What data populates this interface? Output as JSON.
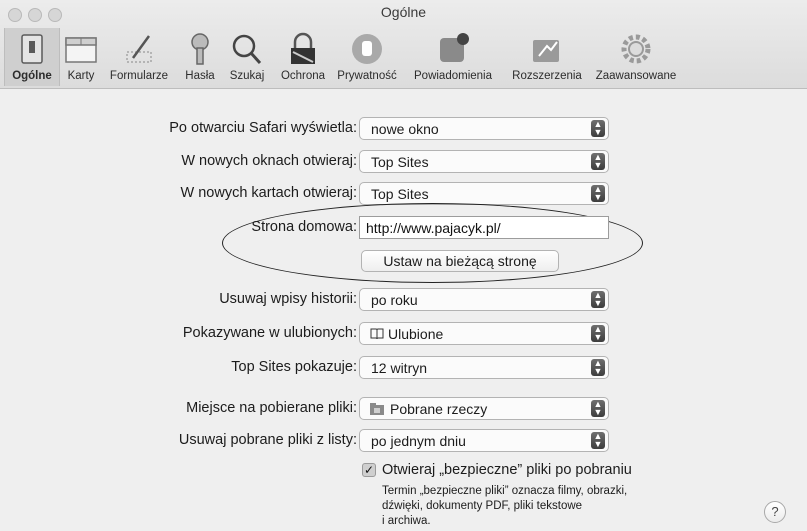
{
  "window": {
    "title": "Ogólne"
  },
  "toolbar": {
    "items": [
      {
        "label": "Ogólne"
      },
      {
        "label": "Karty"
      },
      {
        "label": "Formularze"
      },
      {
        "label": "Hasła"
      },
      {
        "label": "Szukaj"
      },
      {
        "label": "Ochrona"
      },
      {
        "label": "Prywatność"
      },
      {
        "label": "Powiadomienia"
      },
      {
        "label": "Rozszerzenia"
      },
      {
        "label": "Zaawansowane"
      }
    ]
  },
  "settings": {
    "open_with": {
      "label": "Po otwarciu Safari wyświetla:",
      "value": "nowe okno"
    },
    "new_windows": {
      "label": "W nowych oknach otwieraj:",
      "value": "Top Sites"
    },
    "new_tabs": {
      "label": "W nowych kartach otwieraj:",
      "value": "Top Sites"
    },
    "homepage": {
      "label": "Strona domowa:",
      "value": "http://www.pajacyk.pl/",
      "button": "Ustaw na bieżącą stronę"
    },
    "history": {
      "label": "Usuwaj wpisy historii:",
      "value": "po roku"
    },
    "favorites": {
      "label": "Pokazywane w ulubionych:",
      "value": "Ulubione"
    },
    "top_sites": {
      "label": "Top Sites pokazuje:",
      "value": "12 witryn"
    },
    "download_location": {
      "label": "Miejsce na pobierane pliki:",
      "value": "Pobrane rzeczy"
    },
    "remove_downloads": {
      "label": "Usuwaj pobrane pliki z listy:",
      "value": "po jednym dniu"
    },
    "safe_files": {
      "label": "Otwieraj „bezpieczne” pliki po pobraniu",
      "checked": true,
      "description_lines": [
        "Termin „bezpieczne pliki” oznacza filmy, obrazki,",
        "dźwięki, dokumenty PDF, pliki tekstowe",
        "i archiwa."
      ]
    }
  },
  "help": {
    "label": "?"
  }
}
